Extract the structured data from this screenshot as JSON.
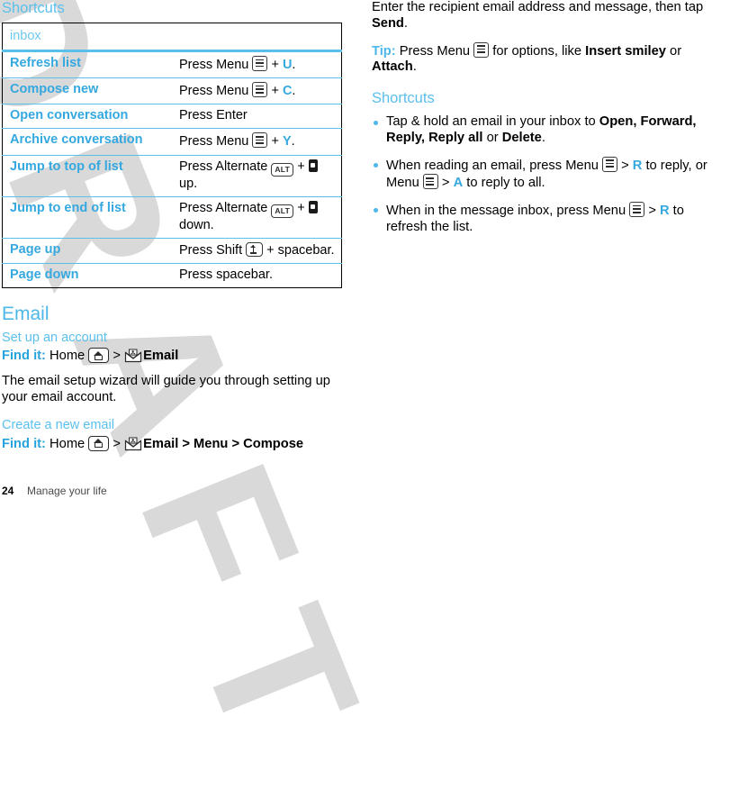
{
  "watermark": {
    "text": "DRAFT",
    "color": "#d9d9d9"
  },
  "colors": {
    "accent_blue": "#35a8e0",
    "heading_blue": "#5bbfec",
    "light_blue_rule": "#5bbfec",
    "body_black": "#000000"
  },
  "left_column": {
    "shortcuts_heading": "Shortcuts",
    "table": {
      "header": "inbox",
      "rows": [
        {
          "action": "Refresh list",
          "pre": "Press Menu",
          "icon": "menu-key-icon",
          "mid": "+",
          "key": "U",
          "post": "."
        },
        {
          "action": "Compose new",
          "pre": "Press Menu",
          "icon": "menu-key-icon",
          "mid": "+",
          "key": "C",
          "post": "."
        },
        {
          "action": "Open conversation",
          "pre": "Press Enter",
          "icon": "",
          "mid": "",
          "key": "",
          "post": ""
        },
        {
          "action": "Archive conversation",
          "pre": "Press Menu",
          "icon": "menu-key-icon",
          "mid": "+",
          "key": "Y",
          "post": "."
        },
        {
          "action": "Jump to top of list",
          "pre": "Press Alternate",
          "icon": "alt-key-icon",
          "mid": "+",
          "key": "",
          "nav": "nav-key-icon",
          "post": "up."
        },
        {
          "action": "Jump to end of list",
          "pre": "Press Alternate",
          "icon": "alt-key-icon",
          "mid": "+",
          "key": "",
          "nav": "nav-key-icon",
          "post": "down."
        },
        {
          "action": "Page up",
          "pre": "Press Shift",
          "icon": "shift-key-icon",
          "mid": "+",
          "key": "",
          "post": "spacebar."
        },
        {
          "action": "Page down",
          "pre": "Press spacebar.",
          "icon": "",
          "mid": "",
          "key": "",
          "post": ""
        }
      ]
    },
    "email_heading": "Email",
    "setup_subheading": "Set up an account",
    "setup_findit": {
      "label": "Find it:",
      "home": "Home",
      "home_icon": "home-key-icon",
      "sep1": ">",
      "email_icon": "email-envelope-icon",
      "email": "Email"
    },
    "setup_body": "The email setup wizard will guide you through setting up your email account.",
    "create_subheading": "Create a new email",
    "create_findit": {
      "label": "Find it:",
      "home": "Home",
      "home_icon": "home-key-icon",
      "sep1": ">",
      "email_icon": "email-envelope-icon",
      "email": "Email",
      "sep2": ">",
      "menu": "Menu",
      "sep3": ">",
      "compose": "Compose"
    }
  },
  "right_column": {
    "intro_p1": "Enter the recipient email address and message, then tap ",
    "intro_p1_bold": "Send",
    "intro_p1_end": ".",
    "tip_label": "Tip:",
    "tip_pre": " Press Menu ",
    "tip_icon": "menu-key-icon",
    "tip_mid": " for options, like ",
    "tip_bold1": "Insert smiley",
    "tip_or": " or ",
    "tip_bold2": "Attach",
    "tip_end": ".",
    "shortcuts_heading": "Shortcuts",
    "bullets": [
      {
        "t1": "Tap & hold an email in your inbox to ",
        "b1": "Open, Forward, Reply, Reply all",
        "t2": " or ",
        "b2": "Delete",
        "t3": "."
      },
      {
        "t1": "When reading an email, press Menu ",
        "icon1": "menu-key-icon",
        "t2": " > ",
        "k1": "R",
        "t3": " to reply, or Menu ",
        "icon2": "menu-key-icon",
        "t4": " > ",
        "k2": "A",
        "t5": " to reply to all."
      },
      {
        "t1": "When in the message inbox, press Menu ",
        "icon1": "menu-key-icon",
        "t2": " > ",
        "k1": "R",
        "t3": " to refresh the list."
      }
    ]
  },
  "footer": {
    "page_number": "24",
    "section_title": "Manage your life"
  }
}
